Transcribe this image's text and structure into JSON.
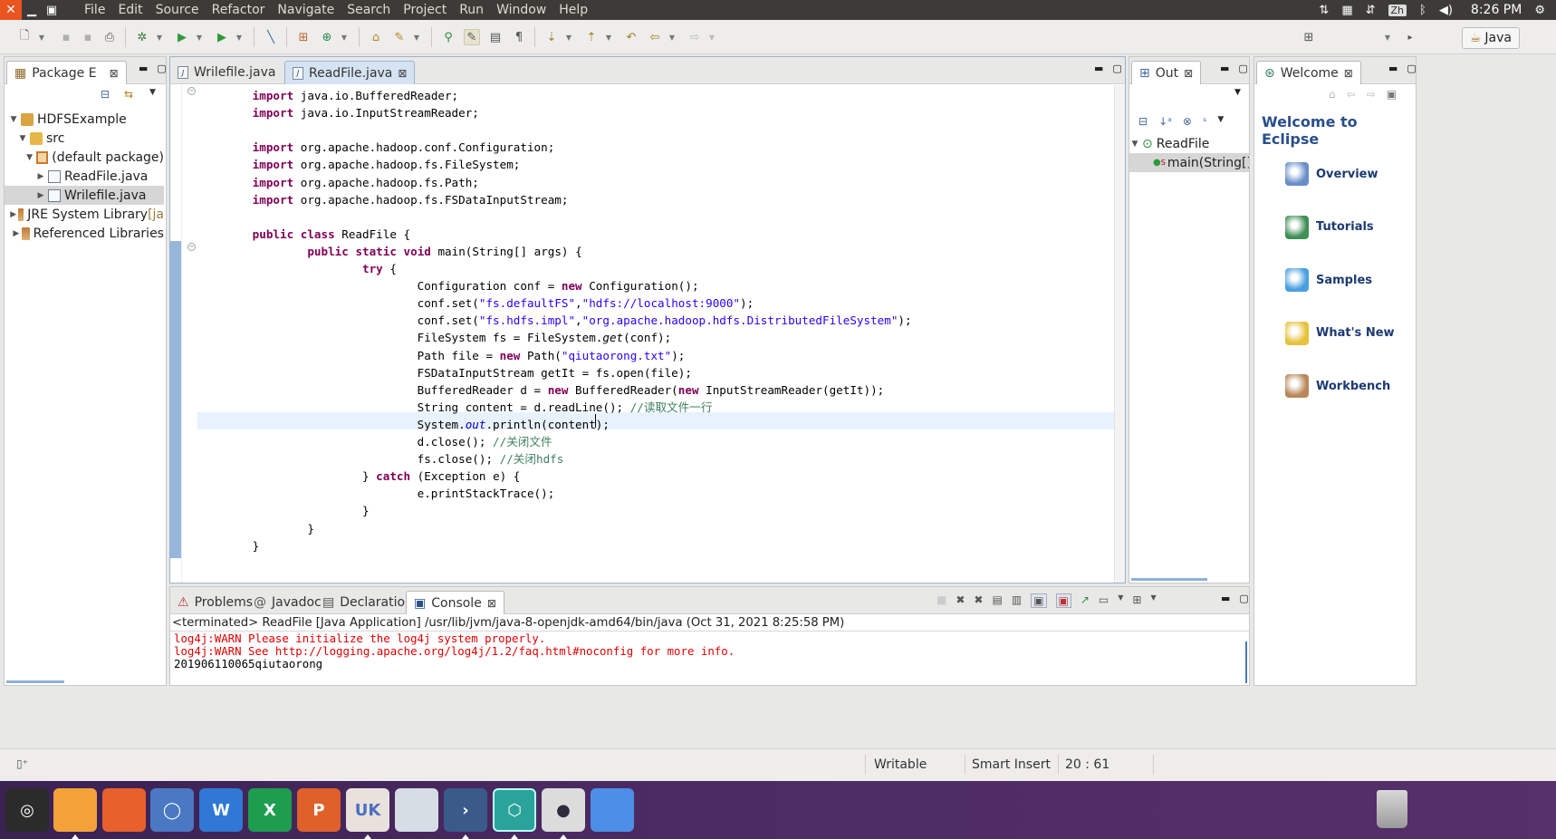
{
  "menubar": {
    "close_glyph": "✕",
    "items": [
      "File",
      "Edit",
      "Source",
      "Refactor",
      "Navigate",
      "Search",
      "Project",
      "Run",
      "Window",
      "Help"
    ],
    "ime": "Zh",
    "clock": "8:26 PM"
  },
  "toolbar": {
    "perspective_label": "Java"
  },
  "package_explorer": {
    "tab_label": "Package E",
    "tree": [
      {
        "label": "HDFSExample",
        "icon": "project-folder-icon",
        "depth": 0,
        "twisty": "▼"
      },
      {
        "label": "src",
        "icon": "source-folder-icon",
        "depth": 1,
        "twisty": "▼"
      },
      {
        "label": "(default package)",
        "icon": "package-icon",
        "depth": 2,
        "twisty": "▼"
      },
      {
        "label": "ReadFile.java",
        "icon": "java-file-icon",
        "depth": 3,
        "twisty": "▶"
      },
      {
        "label": "Wrilefile.java",
        "icon": "java-file-icon",
        "depth": 3,
        "twisty": "▶",
        "selected": true
      },
      {
        "label": "JRE System Library",
        "suffix": " [ja",
        "icon": "library-icon",
        "depth": 1,
        "twisty": "▶"
      },
      {
        "label": "Referenced Libraries",
        "icon": "library-icon",
        "depth": 1,
        "twisty": "▶"
      }
    ]
  },
  "editor": {
    "tabs": [
      {
        "label": "Wrilefile.java",
        "active": false
      },
      {
        "label": "ReadFile.java",
        "active": true
      }
    ],
    "code": [
      [
        [
          "kw",
          "import"
        ],
        [
          "t",
          " java.io.BufferedReader;"
        ]
      ],
      [
        [
          "kw",
          "import"
        ],
        [
          "t",
          " java.io.InputStreamReader;"
        ]
      ],
      [],
      [
        [
          "kw",
          "import"
        ],
        [
          "t",
          " org.apache.hadoop.conf.Configuration;"
        ]
      ],
      [
        [
          "kw",
          "import"
        ],
        [
          "t",
          " org.apache.hadoop.fs.FileSystem;"
        ]
      ],
      [
        [
          "kw",
          "import"
        ],
        [
          "t",
          " org.apache.hadoop.fs.Path;"
        ]
      ],
      [
        [
          "kw",
          "import"
        ],
        [
          "t",
          " org.apache.hadoop.fs.FSDataInputStream;"
        ]
      ],
      [],
      [
        [
          "kw",
          "public"
        ],
        [
          "t",
          " "
        ],
        [
          "kw",
          "class"
        ],
        [
          "t",
          " ReadFile {"
        ]
      ],
      [
        [
          "t",
          "        "
        ],
        [
          "kw",
          "public"
        ],
        [
          "t",
          " "
        ],
        [
          "kw",
          "static"
        ],
        [
          "t",
          " "
        ],
        [
          "kw",
          "void"
        ],
        [
          "t",
          " main(String[] args) {"
        ]
      ],
      [
        [
          "t",
          "                "
        ],
        [
          "kw",
          "try"
        ],
        [
          "t",
          " {"
        ]
      ],
      [
        [
          "t",
          "                        Configuration conf = "
        ],
        [
          "kw",
          "new"
        ],
        [
          "t",
          " Configuration();"
        ]
      ],
      [
        [
          "t",
          "                        conf.set("
        ],
        [
          "str",
          "\"fs.defaultFS\""
        ],
        [
          "t",
          ","
        ],
        [
          "str",
          "\"hdfs://localhost:9000\""
        ],
        [
          "t",
          ");"
        ]
      ],
      [
        [
          "t",
          "                        conf.set("
        ],
        [
          "str",
          "\"fs.hdfs.impl\""
        ],
        [
          "t",
          ","
        ],
        [
          "str",
          "\"org.apache.hadoop.hdfs.DistributedFileSystem\""
        ],
        [
          "t",
          ");"
        ]
      ],
      [
        [
          "t",
          "                        FileSystem fs = FileSystem."
        ],
        [
          "it",
          "get"
        ],
        [
          "t",
          "(conf);"
        ]
      ],
      [
        [
          "t",
          "                        Path file = "
        ],
        [
          "kw",
          "new"
        ],
        [
          "t",
          " Path("
        ],
        [
          "str",
          "\"qiutaorong.txt\""
        ],
        [
          "t",
          ");"
        ]
      ],
      [
        [
          "t",
          "                        FSDataInputStream getIt = fs.open(file);"
        ]
      ],
      [
        [
          "t",
          "                        BufferedReader d = "
        ],
        [
          "kw",
          "new"
        ],
        [
          "t",
          " BufferedReader("
        ],
        [
          "kw",
          "new"
        ],
        [
          "t",
          " InputStreamReader(getIt));"
        ]
      ],
      [
        [
          "t",
          "                        String content = d.readLine(); "
        ],
        [
          "cmt",
          "//读取文件一行"
        ]
      ],
      [
        [
          "t",
          "                        System."
        ],
        [
          "fld",
          "out"
        ],
        [
          "t",
          ".println(content);"
        ]
      ],
      [
        [
          "t",
          "                        d.close(); "
        ],
        [
          "cmt",
          "//关闭文件"
        ]
      ],
      [
        [
          "t",
          "                        fs.close(); "
        ],
        [
          "cmt",
          "//关闭hdfs"
        ]
      ],
      [
        [
          "t",
          "                } "
        ],
        [
          "kw",
          "catch"
        ],
        [
          "t",
          " (Exception e) {"
        ]
      ],
      [
        [
          "t",
          "                        e.printStackTrace();"
        ]
      ],
      [
        [
          "t",
          "                }"
        ]
      ],
      [
        [
          "t",
          "        }"
        ]
      ],
      [
        [
          "t",
          "}"
        ]
      ]
    ]
  },
  "outline": {
    "tab_label": "Out",
    "items": [
      {
        "label": "ReadFile",
        "icon": "class-icon"
      },
      {
        "label": "main(String[]",
        "icon": "method-icon",
        "superscript": "S"
      }
    ]
  },
  "welcome": {
    "tab_label": "Welcome",
    "title": "Welcome to Eclipse",
    "links": [
      {
        "label": "Overview",
        "icon": "overview-icon",
        "color": "#6a8fc8"
      },
      {
        "label": "Tutorials",
        "icon": "tutorials-icon",
        "color": "#3f8f56"
      },
      {
        "label": "Samples",
        "icon": "samples-icon",
        "color": "#4a9fe0"
      },
      {
        "label": "What's New",
        "icon": "whats-new-icon",
        "color": "#e6c23a"
      },
      {
        "label": "Workbench",
        "icon": "workbench-icon",
        "color": "#b9865a"
      }
    ]
  },
  "bottom": {
    "tabs": [
      "Problems",
      "Javadoc",
      "Declaration",
      "Console"
    ],
    "active_tab": "Console",
    "header": "<terminated> ReadFile [Java Application] /usr/lib/jvm/java-8-openjdk-amd64/bin/java (Oct 31, 2021 8:25:58 PM)",
    "lines": [
      {
        "text": "log4j:WARN Please initialize the log4j system properly.",
        "color": "#e00000"
      },
      {
        "text": "log4j:WARN See http://logging.apache.org/log4j/1.2/faq.html#noconfig for more info.",
        "color": "#e00000"
      },
      {
        "text": "201906110065qiutaorong",
        "color": "#000000"
      }
    ]
  },
  "statusbar": {
    "writable": "Writable",
    "insert_mode": "Smart Insert",
    "position": "20 : 61"
  },
  "dock": {
    "items": [
      {
        "name": "ubuntu-dash-icon",
        "bg": "#2b2b2b",
        "glyph": "◎"
      },
      {
        "name": "files-icon",
        "bg": "#f3a23a",
        "glyph": ""
      },
      {
        "name": "firefox-icon",
        "bg": "#e8602c",
        "glyph": ""
      },
      {
        "name": "chromium-icon",
        "bg": "#4a78c2",
        "glyph": "◯"
      },
      {
        "name": "writer-icon",
        "bg": "#2f78d4",
        "glyph": "W"
      },
      {
        "name": "calc-icon",
        "bg": "#1e9d4f",
        "glyph": "X"
      },
      {
        "name": "impress-icon",
        "bg": "#e0602a",
        "glyph": "P"
      },
      {
        "name": "software-center-icon",
        "bg": "#e9e2dc",
        "glyph": "UK"
      },
      {
        "name": "installer-icon",
        "bg": "#d6dde5",
        "glyph": ""
      },
      {
        "name": "vscode-icon",
        "bg": "#3a5a8a",
        "glyph": "›"
      },
      {
        "name": "pycharm-icon",
        "bg": "#2aa39a",
        "glyph": "⬡"
      },
      {
        "name": "eclipse-icon",
        "bg": "#dcdcdc",
        "glyph": "●"
      },
      {
        "name": "workspaces-icon",
        "bg": "#4c8ee6",
        "glyph": ""
      }
    ],
    "trash": "trash-icon"
  }
}
